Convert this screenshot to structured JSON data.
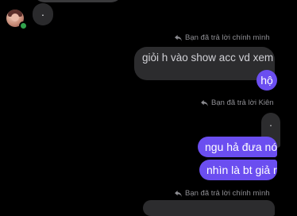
{
  "messages": {
    "incoming_dot": ".",
    "reply1": {
      "label": "Bạn đã trả lời chính mình",
      "quoted": "giỏi h vào show acc vd xem"
    },
    "sent1": "hộ",
    "reply2": {
      "label": "Bạn đã trả lời Kiên",
      "quoted": "."
    },
    "sent2": "ngu hả đưa nó",
    "sent3": "nhìn là bt giả r",
    "reply3": {
      "label": "Bạn đã trả lời chính mình"
    }
  },
  "colors": {
    "background": "#000000",
    "sent_bubble": "#6b4ef0",
    "quoted_bubble": "#2c2c2e",
    "incoming_bubble": "#2a2a2c",
    "muted_text": "#8e8e93",
    "online": "#31a24c"
  },
  "icons": {
    "reply": "reply-arrow-icon"
  }
}
